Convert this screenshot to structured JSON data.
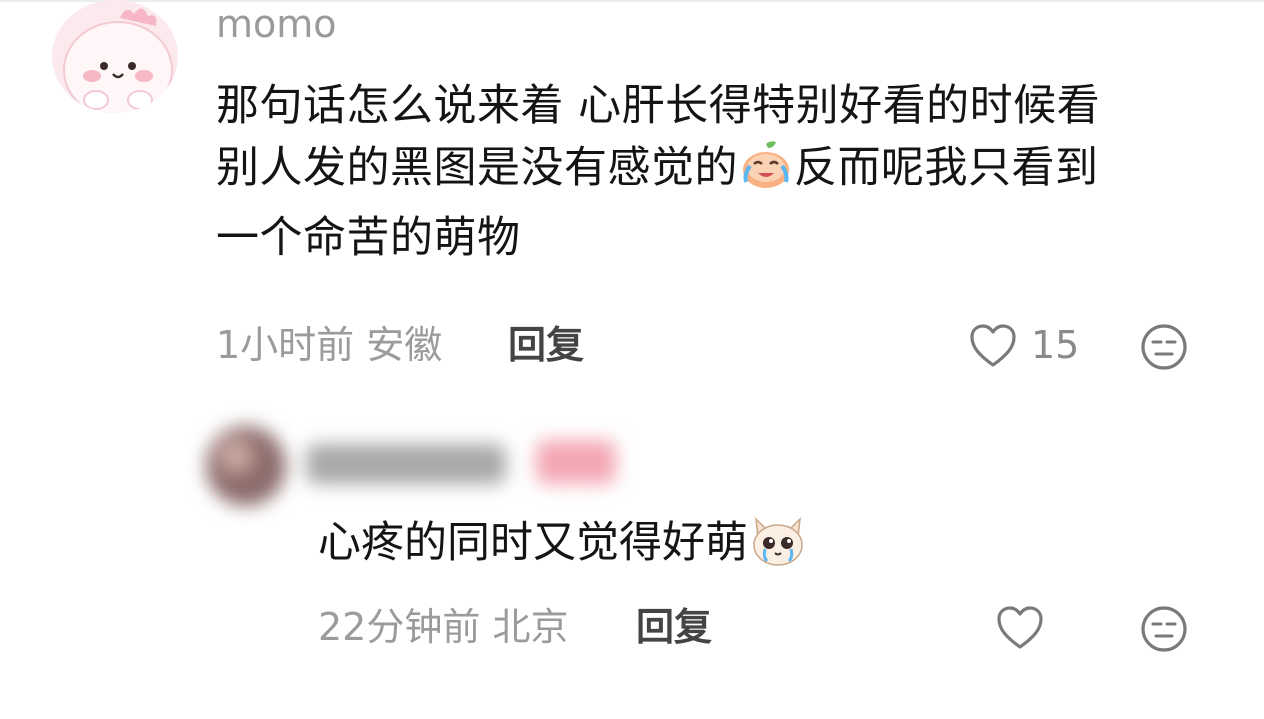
{
  "comment": {
    "username": "momo",
    "text_part1": "那句话怎么说来着 心肝长得特别好看的时候看",
    "text_part2": "别人发的黑图是没有感觉的",
    "emoji_1": "crying-peach-emoji",
    "text_part3": "反而呢我只看到",
    "text_part4": "一个命苦的萌物",
    "time": "1小时前",
    "location": "安徽",
    "reply_label": "回复",
    "like_count": "15"
  },
  "sub_reply": {
    "text": "心疼的同时又觉得好萌",
    "emoji": "crying-cat-emoji",
    "time": "22分钟前",
    "location": "北京",
    "reply_label": "回复"
  },
  "colors": {
    "meta_gray": "#9b9b9b",
    "text_dark": "#141414",
    "avatar_pink": "#fbe9ee"
  }
}
